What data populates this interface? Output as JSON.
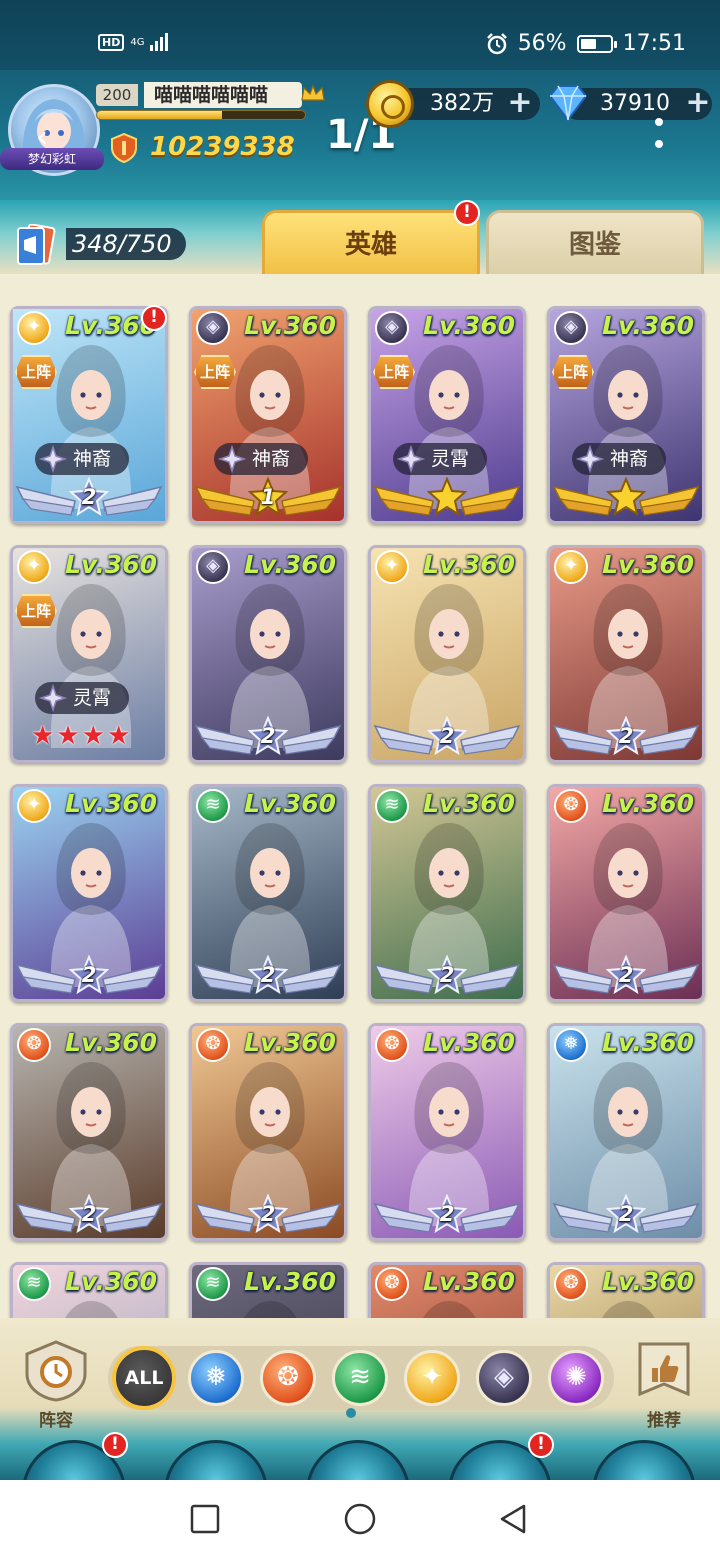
{
  "status_bar": {
    "hd": "HD",
    "network": "4G",
    "battery_percent": "56%",
    "battery_level": 0.56,
    "time": "17:51"
  },
  "profile": {
    "level": "200",
    "name": "喵喵喵喵喵喵",
    "avatar_ribbon": "梦幻彩虹",
    "power": "10239338",
    "exp_fraction": 0.6
  },
  "page_indicator": "1/1",
  "currency": {
    "gold": "382万",
    "gems": "37910"
  },
  "hero_count": "348/750",
  "tabs": [
    {
      "label": "英雄",
      "active": true,
      "alert": "!"
    },
    {
      "label": "图鉴",
      "active": false
    }
  ],
  "cards": [
    {
      "level": "Lv.360",
      "faction": "light",
      "deployed": "上阵",
      "title": "神裔",
      "star_tier": "2",
      "style": "silver",
      "alert": "!",
      "palette": [
        "#bfe6f8",
        "#5aa6d8"
      ]
    },
    {
      "level": "Lv.360",
      "faction": "dark",
      "deployed": "上阵",
      "title": "神裔",
      "star_tier": "1",
      "style": "gold",
      "palette": [
        "#f1a36f",
        "#a6322c"
      ]
    },
    {
      "level": "Lv.360",
      "faction": "dark",
      "deployed": "上阵",
      "title": "灵霄",
      "star_tier": "",
      "style": "goldstar",
      "palette": [
        "#c8a3e8",
        "#4e3d8e"
      ]
    },
    {
      "level": "Lv.360",
      "faction": "dark",
      "deployed": "上阵",
      "title": "神裔",
      "star_tier": "",
      "style": "goldstar",
      "palette": [
        "#b6a5df",
        "#3e3570"
      ]
    },
    {
      "level": "Lv.360",
      "faction": "light",
      "deployed": "上阵",
      "title": "灵霄",
      "red_stars": 4,
      "style": "redstars",
      "palette": [
        "#e8e3df",
        "#6b7da3"
      ]
    },
    {
      "level": "Lv.360",
      "faction": "dark",
      "star_tier": "2",
      "style": "silver",
      "palette": [
        "#a89ccc",
        "#3d3a5e"
      ]
    },
    {
      "level": "Lv.360",
      "faction": "light",
      "star_tier": "2",
      "style": "silver",
      "palette": [
        "#f6e3b2",
        "#c9a566"
      ]
    },
    {
      "level": "Lv.360",
      "faction": "light",
      "star_tier": "2",
      "style": "silver",
      "palette": [
        "#e79a87",
        "#7d3834"
      ]
    },
    {
      "level": "Lv.360",
      "faction": "light",
      "star_tier": "2",
      "style": "silver",
      "palette": [
        "#9ad3f0",
        "#5c3d95"
      ]
    },
    {
      "level": "Lv.360",
      "faction": "wind",
      "star_tier": "2",
      "style": "silver",
      "palette": [
        "#a6b8c8",
        "#2f3e55"
      ]
    },
    {
      "level": "Lv.360",
      "faction": "wind",
      "star_tier": "2",
      "style": "silver",
      "palette": [
        "#d3c795",
        "#3f6d4e"
      ]
    },
    {
      "level": "Lv.360",
      "faction": "fire",
      "star_tier": "2",
      "style": "silver",
      "palette": [
        "#f4a9a5",
        "#6b2f55"
      ]
    },
    {
      "level": "Lv.360",
      "faction": "fire",
      "star_tier": "2",
      "style": "silver",
      "palette": [
        "#b7b5b0",
        "#5a3b2a"
      ]
    },
    {
      "level": "Lv.360",
      "faction": "fire",
      "star_tier": "2",
      "style": "silver",
      "palette": [
        "#f0c894",
        "#8b4a24"
      ]
    },
    {
      "level": "Lv.360",
      "faction": "fire",
      "star_tier": "2",
      "style": "silver",
      "palette": [
        "#f0cbe8",
        "#8a5ab5"
      ]
    },
    {
      "level": "Lv.360",
      "faction": "water",
      "star_tier": "2",
      "style": "silver",
      "palette": [
        "#c9e2ec",
        "#6e8ea8"
      ]
    },
    {
      "level": "Lv.360",
      "faction": "wind",
      "star_tier": "",
      "style": "partial",
      "palette": [
        "#f2d6dc",
        "#8e9ab6"
      ]
    },
    {
      "level": "Lv.360",
      "faction": "wind",
      "star_tier": "",
      "style": "partial",
      "palette": [
        "#6f6a7e",
        "#2c2c3e"
      ]
    },
    {
      "level": "Lv.360",
      "faction": "fire",
      "star_tier": "",
      "style": "partial",
      "palette": [
        "#e28b6b",
        "#7a2f2a"
      ]
    },
    {
      "level": "Lv.360",
      "faction": "fire",
      "star_tier": "",
      "style": "partial",
      "palette": [
        "#e9d8a6",
        "#8a6b3a"
      ]
    }
  ],
  "filter_bar": {
    "lineup_label": "阵容",
    "recommend_label": "推荐",
    "all_label": "ALL",
    "factions": [
      "water",
      "fire",
      "wind",
      "light",
      "dark",
      "void"
    ]
  },
  "bottom_tabs": [
    {
      "alert": "!"
    },
    {},
    {},
    {
      "alert": "!"
    },
    {}
  ],
  "colors": {
    "header": "#1b7890",
    "grid_bg": "#f1ecd6",
    "level_text": "#c7f24b",
    "alert": "#e32522",
    "tab_active": "#f1c046"
  }
}
